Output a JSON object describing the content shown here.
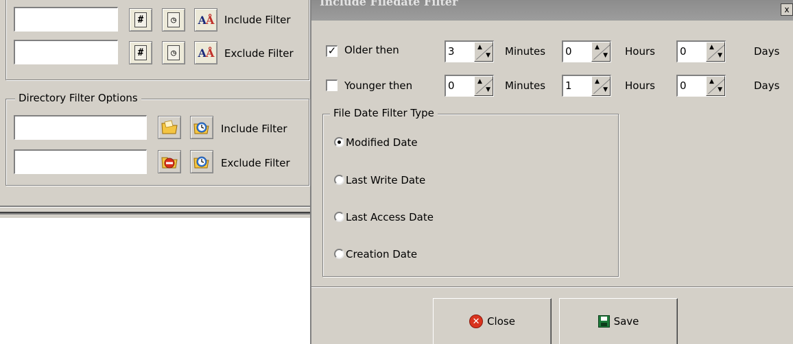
{
  "left_panel": {
    "file_filters": [
      {
        "label": "Include Filter",
        "value": ""
      },
      {
        "label": "Exclude Filter",
        "value": ""
      }
    ],
    "file_filter_icons": [
      "hash-icon",
      "clock-icon",
      "case-sensitive-icon"
    ],
    "directory_group_title": "Directory Filter Options",
    "directory_filters": [
      {
        "label": "Include Filter",
        "value": ""
      },
      {
        "label": "Exclude Filter",
        "value": ""
      }
    ]
  },
  "dialog": {
    "title": "Include Filedate Filter",
    "close_glyph": "x",
    "rows": [
      {
        "label": "Older then",
        "checked": true,
        "minutes": "3",
        "hours": "0",
        "days": "0",
        "minutes_label": "Minutes",
        "hours_label": "Hours",
        "days_label": "Days"
      },
      {
        "label": "Younger then",
        "checked": false,
        "minutes": "0",
        "hours": "1",
        "days": "0",
        "minutes_label": "Minutes",
        "hours_label": "Hours",
        "days_label": "Days"
      }
    ],
    "date_type_group": {
      "title": "File Date Filter Type",
      "options": [
        "Modified Date",
        "Last Write Date",
        "Last Access Date",
        "Creation Date"
      ],
      "selected": "Modified Date"
    },
    "buttons": {
      "close": "Close",
      "save": "Save"
    }
  }
}
